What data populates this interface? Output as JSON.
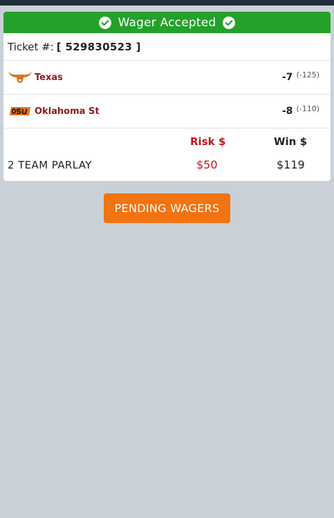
{
  "banner": {
    "title": "Wager Accepted",
    "icon": "check-circle-icon",
    "color": "#23a12a"
  },
  "ticket": {
    "label": "Ticket #:",
    "number": "[ 529830523 ]"
  },
  "teams": [
    {
      "name": "Texas",
      "logo_icon": "longhorn-logo-icon",
      "line": "-7",
      "odds": "(-125)"
    },
    {
      "name": "Oklahoma St",
      "logo_icon": "osu-logo-icon",
      "line": "-8",
      "odds": "(-110)"
    }
  ],
  "parlay": {
    "type": "2 TEAM PARLAY",
    "risk_label": "Risk $",
    "win_label": "Win $",
    "risk_value": "$50",
    "win_value": "$119"
  },
  "pending_button": {
    "label": "PENDING WAGERS",
    "color": "#f27312"
  }
}
